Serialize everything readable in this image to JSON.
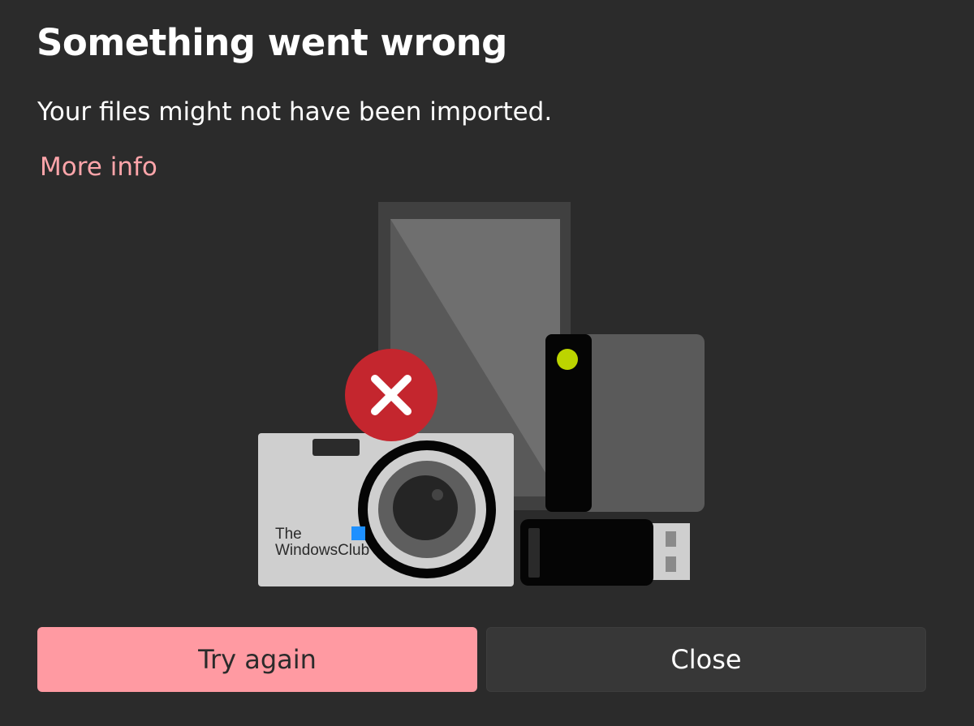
{
  "dialog": {
    "title": "Something went wrong",
    "message": "Your files might not have been imported.",
    "more_info_link": "More info"
  },
  "illustration": {
    "icons": [
      "tablet-icon",
      "external-drive-icon",
      "usb-drive-icon",
      "camera-icon",
      "error-x-icon"
    ],
    "error_color": "#c4262e",
    "led_color": "#bcd400"
  },
  "watermark": {
    "line1": "The",
    "line2": "WindowsClub"
  },
  "buttons": {
    "try_again_label": "Try again",
    "close_label": "Close"
  },
  "colors": {
    "background": "#2b2b2b",
    "accent": "#ff9aa2",
    "link": "#ffa5aa",
    "secondary_button": "#373737"
  }
}
